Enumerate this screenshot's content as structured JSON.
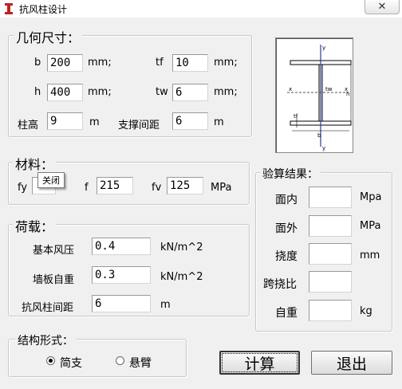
{
  "window": {
    "title": "抗风柱设计",
    "close_glyph": "✕"
  },
  "geometry": {
    "legend": "几何尺寸：",
    "b": {
      "label": "b",
      "value": "200",
      "unit": "mm;"
    },
    "tf": {
      "label": "tf",
      "value": "10",
      "unit": "mm;"
    },
    "h": {
      "label": "h",
      "value": "400",
      "unit": "mm;"
    },
    "tw": {
      "label": "tw",
      "value": "6",
      "unit": "mm;"
    },
    "col_height": {
      "label": "柱高",
      "value": "9",
      "unit": "m"
    },
    "brace_spacing": {
      "label": "支撑间距",
      "value": "6",
      "unit": "m"
    }
  },
  "figure": {
    "y_top": "y",
    "y_bottom": "y",
    "x_left": "x",
    "x_right": "x",
    "tw": "tw",
    "tf": "tf",
    "h": "h",
    "b": "b"
  },
  "material": {
    "legend": "材料：",
    "fy": {
      "label": "fy",
      "value": ""
    },
    "f": {
      "label": "f",
      "value": "215"
    },
    "fv": {
      "label": "fv",
      "value": "125",
      "unit": "MPa"
    },
    "tooltip": "关闭"
  },
  "load": {
    "legend": "荷载：",
    "wind": {
      "label": "基本风压",
      "value": "0.4",
      "unit": "kN/m^2"
    },
    "wall": {
      "label": "墙板自重",
      "value": "0.3",
      "unit": "kN/m^2"
    },
    "spacing": {
      "label": "抗风柱间距",
      "value": "6",
      "unit": "m"
    }
  },
  "structure": {
    "legend": "结构形式：",
    "simple": {
      "label": "简支",
      "selected": true
    },
    "cantilever": {
      "label": "悬臂",
      "selected": false
    }
  },
  "results": {
    "legend": "验算结果：",
    "in_plane": {
      "label": "面内",
      "value": "",
      "unit": "Mpa"
    },
    "out_plane": {
      "label": "面外",
      "value": "",
      "unit": "MPa"
    },
    "deflection": {
      "label": "挠度",
      "value": "",
      "unit": "mm"
    },
    "span_deflection": {
      "label": "跨挠比",
      "value": ""
    },
    "self_weight": {
      "label": "自重",
      "value": "",
      "unit": "kg"
    }
  },
  "buttons": {
    "calculate": "计算",
    "exit": "退出"
  }
}
